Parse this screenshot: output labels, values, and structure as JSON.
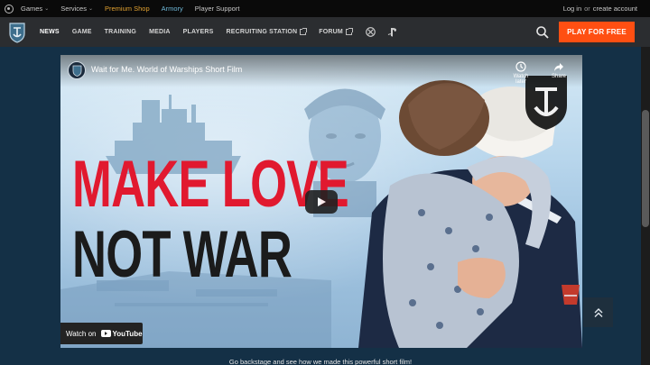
{
  "topbar": {
    "items": [
      {
        "label": "Games",
        "dropdown": true,
        "color": "#c8c8c8"
      },
      {
        "label": "Services",
        "dropdown": true,
        "color": "#c8c8c8"
      },
      {
        "label": "Premium Shop",
        "dropdown": false,
        "color": "#e0a030"
      },
      {
        "label": "Armory",
        "dropdown": false,
        "color": "#6fb8d8"
      },
      {
        "label": "Player Support",
        "dropdown": false,
        "color": "#c8c8c8"
      }
    ],
    "login_label": "Log in",
    "or_label": "or",
    "create_label": "create account"
  },
  "nav": {
    "items": [
      {
        "label": "NEWS",
        "active": true
      },
      {
        "label": "GAME"
      },
      {
        "label": "TRAINING"
      },
      {
        "label": "MEDIA"
      },
      {
        "label": "PLAYERS"
      },
      {
        "label": "RECRUITING STATION",
        "external": true
      },
      {
        "label": "FORUM",
        "external": true
      }
    ],
    "platform_icons": [
      "xbox-icon",
      "playstation-icon"
    ],
    "play_label": "PLAY FOR FREE"
  },
  "video": {
    "title": "Wait for Me. World of Warships Short Film",
    "watch_later_label": "Watch later",
    "share_label": "Share",
    "headline_line1": "MAKE LOVE",
    "headline_line2": "NOT WAR",
    "watch_on_label": "Watch on",
    "youtube_label": "YouTube"
  },
  "caption": "Go backstage and see how we made this powerful short film!",
  "colors": {
    "accent": "#ff4f12",
    "headline_red": "#e1192f",
    "page_bg": "#143046"
  }
}
